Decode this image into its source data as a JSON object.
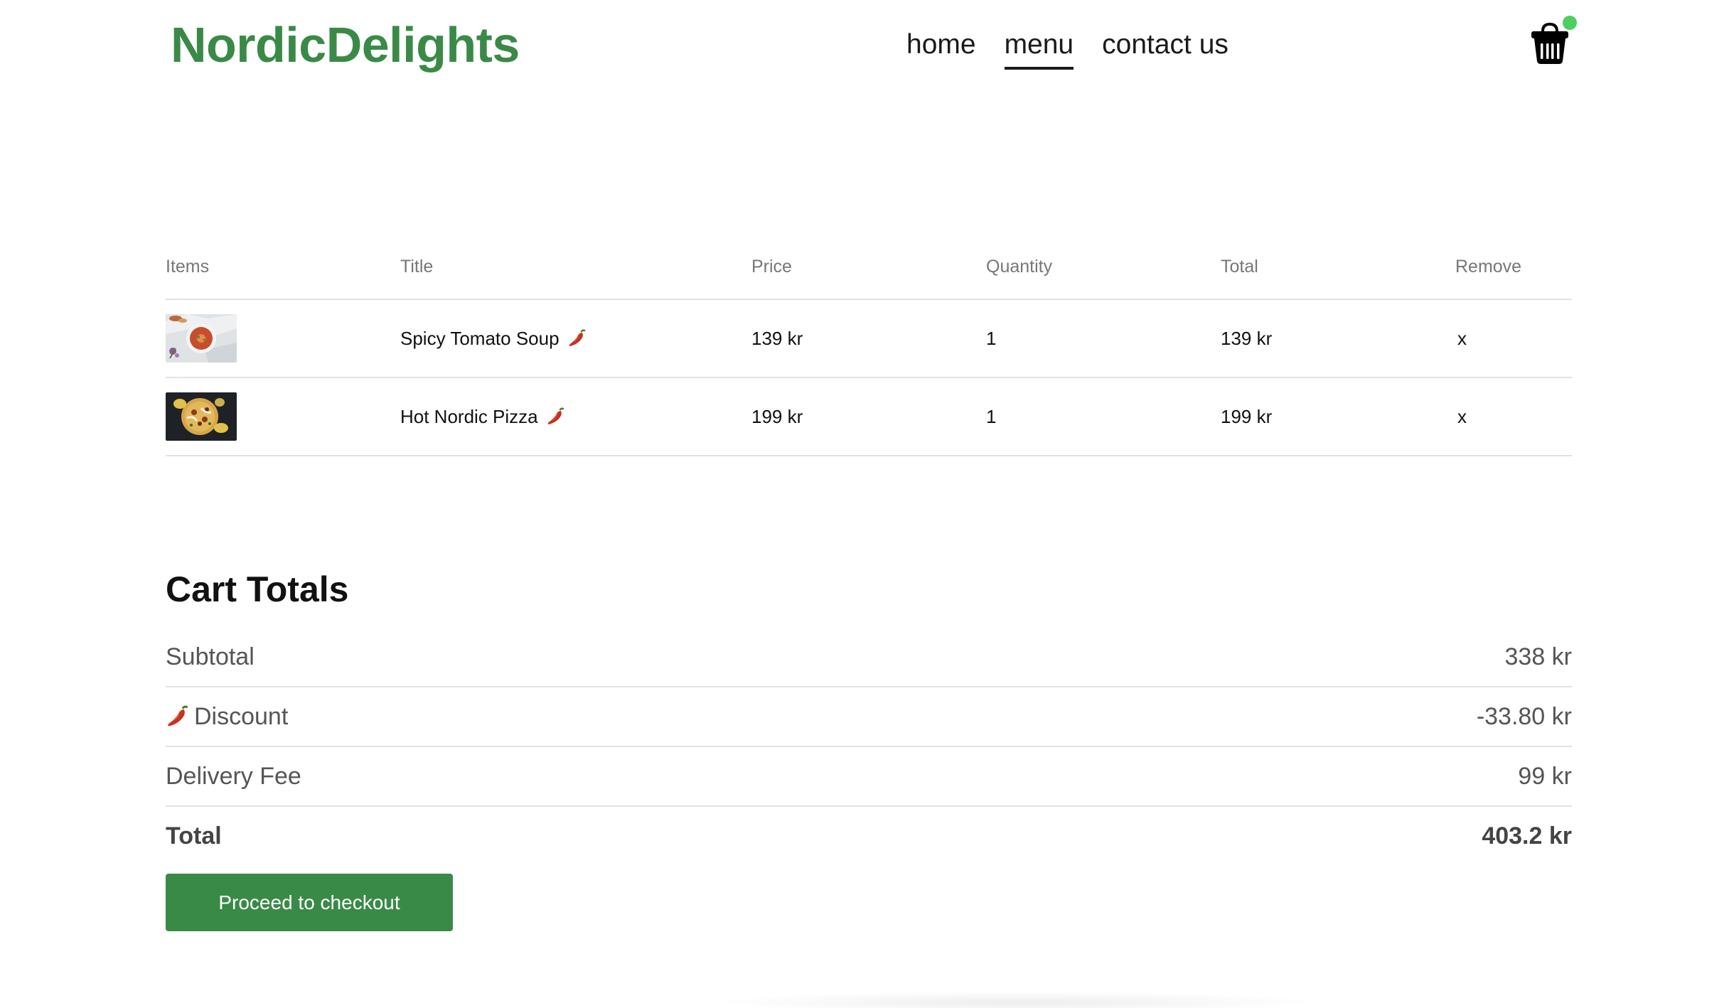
{
  "header": {
    "logo": "NordicDelights",
    "nav": [
      {
        "label": "home",
        "active": false
      },
      {
        "label": "menu",
        "active": true
      },
      {
        "label": "contact us",
        "active": false
      }
    ],
    "cart_icon": "basket-icon",
    "cart_indicator_color": "#4ccf5e"
  },
  "cart": {
    "columns": [
      "Items",
      "Title",
      "Price",
      "Quantity",
      "Total",
      "Remove"
    ],
    "items": [
      {
        "image": "tomato-soup-thumbnail",
        "title": "Spicy Tomato Soup",
        "spicy_icon": "chili-icon",
        "price": "139 kr",
        "quantity": "1",
        "total": "139 kr",
        "remove": "x"
      },
      {
        "image": "nordic-pizza-thumbnail",
        "title": "Hot Nordic Pizza",
        "spicy_icon": "chili-icon",
        "price": "199 kr",
        "quantity": "1",
        "total": "199 kr",
        "remove": "x"
      }
    ]
  },
  "totals": {
    "title": "Cart Totals",
    "subtotal_label": "Subtotal",
    "subtotal_value": "338 kr",
    "discount_label": "Discount",
    "discount_value": "-33.80 kr",
    "delivery_label": "Delivery Fee",
    "delivery_value": "99 kr",
    "total_label": "Total",
    "total_value": "403.2 kr"
  },
  "checkout_button": "Proceed to checkout",
  "colors": {
    "brand_green": "#3a8a47",
    "divider": "#e2e2e2",
    "chili_red": "#c8321e"
  }
}
